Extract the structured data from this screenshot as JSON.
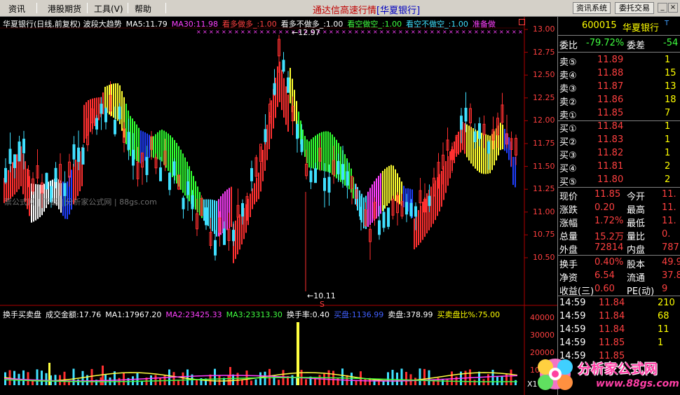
{
  "menubar": {
    "items": [
      "资讯",
      "港股期货",
      "工具(V)",
      "帮助"
    ],
    "app_title": "通达信高速行情",
    "stock_tag": "[华夏银行]",
    "buttons": [
      "资讯系统",
      "委托交易"
    ]
  },
  "chart": {
    "title": "华夏银行(日线,前复权) 波段大趋势",
    "ma5": "MA5:11.79",
    "ma30": "MA30:11.98",
    "signals": [
      {
        "text": "看多做多_:1.00",
        "color": "#ff4040"
      },
      {
        "text": "看多不做多_:1.00",
        "color": "#ffffff"
      },
      {
        "text": "看空做空_:1.00",
        "color": "#40ff40"
      },
      {
        "text": "看空不做空_:1.00",
        "color": "#40e0ff"
      },
      {
        "text": "准备做",
        "color": "#ff40ff"
      }
    ],
    "high_label": "12.97",
    "low_label": "10.11",
    "price_axis": [
      "13.00",
      "12.75",
      "12.50",
      "12.25",
      "12.00",
      "11.75",
      "11.50",
      "11.25",
      "11.00",
      "10.75",
      "10.50"
    ],
    "watermark_text": "票公式网 | 下载 | 分析家公式网 | 88gs.com",
    "marker_s": "S",
    "icon": "close-box-icon"
  },
  "volume": {
    "title": "换手买卖盘",
    "items": [
      {
        "text": "成交金额:17.76",
        "color": "#ffffff"
      },
      {
        "text": "MA1:17967.20",
        "color": "#ffffff"
      },
      {
        "text": "MA2:23425.33",
        "color": "#ff40ff"
      },
      {
        "text": "MA3:23313.30",
        "color": "#40ff40"
      },
      {
        "text": "换手率:0.40",
        "color": "#ffffff"
      },
      {
        "text": "买盘:1136.99",
        "color": "#4060ff"
      },
      {
        "text": "卖盘:378.99",
        "color": "#ffffff"
      },
      {
        "text": "买卖盘比%:75.00",
        "color": "#ffff00"
      }
    ],
    "axis": [
      "40000",
      "30000",
      "20000",
      "10000"
    ],
    "zoom_label": "X1"
  },
  "quote": {
    "code": "600015",
    "name": "华夏银行",
    "wei_bi_label": "委比",
    "wei_bi": "-79.72%",
    "wei_cha_label": "委差",
    "wei_cha": "-54",
    "asks": [
      {
        "label": "卖⑤",
        "price": "11.89",
        "vol": "1"
      },
      {
        "label": "卖④",
        "price": "11.88",
        "vol": "15"
      },
      {
        "label": "卖③",
        "price": "11.87",
        "vol": "13"
      },
      {
        "label": "卖②",
        "price": "11.86",
        "vol": "18"
      },
      {
        "label": "卖①",
        "price": "11.85",
        "vol": "7"
      }
    ],
    "bids": [
      {
        "label": "买①",
        "price": "11.84",
        "vol": "1"
      },
      {
        "label": "买②",
        "price": "11.83",
        "vol": "1"
      },
      {
        "label": "买③",
        "price": "11.82",
        "vol": "1"
      },
      {
        "label": "买④",
        "price": "11.81",
        "vol": "2"
      },
      {
        "label": "买⑤",
        "price": "11.80",
        "vol": "2"
      }
    ],
    "stats": [
      {
        "l1": "现价",
        "v1": "11.85",
        "l2": "今开",
        "v2": "11."
      },
      {
        "l1": "涨跌",
        "v1": "0.20",
        "l2": "最高",
        "v2": "11."
      },
      {
        "l1": "涨幅",
        "v1": "1.72%",
        "l2": "最低",
        "v2": "11."
      },
      {
        "l1": "总量",
        "v1": "15.2万",
        "l2": "量比",
        "v2": "0."
      },
      {
        "l1": "外盘",
        "v1": "72814",
        "l2": "内盘",
        "v2": "787"
      }
    ],
    "stats2": [
      {
        "l1": "换手",
        "v1": "0.40%",
        "l2": "股本",
        "v2": "49.9"
      },
      {
        "l1": "净资",
        "v1": "6.54",
        "l2": "流通",
        "v2": "37.8"
      },
      {
        "l1": "收益(三)",
        "v1": "0.60",
        "l2": "PE(动)",
        "v2": "9"
      }
    ],
    "ticks": [
      {
        "time": "14:59",
        "price": "11.84",
        "vol": "210"
      },
      {
        "time": "14:59",
        "price": "11.84",
        "vol": "68"
      },
      {
        "time": "14:59",
        "price": "11.84",
        "vol": "11"
      },
      {
        "time": "14:59",
        "price": "11.85",
        "vol": "1"
      },
      {
        "time": "14:59",
        "price": "11.85",
        "vol": ""
      }
    ]
  },
  "watermark": {
    "title": "分析家公式网",
    "url": "www.88gs.com"
  }
}
